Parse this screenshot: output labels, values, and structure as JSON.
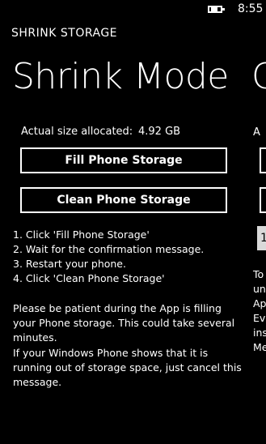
{
  "status_bar": {
    "time": "8:55",
    "battery_icon": "battery-charging-icon"
  },
  "app": {
    "title": "SHRINK STORAGE"
  },
  "pivot": {
    "current": "Shrink Mode",
    "next_peek": "C"
  },
  "allocation": {
    "label": "Actual size allocated:",
    "value": "4.92 GB"
  },
  "buttons": {
    "fill": "Fill Phone Storage",
    "clean": "Clean Phone Storage"
  },
  "steps": [
    "1. Click 'Fill Phone Storage'",
    "2. Wait for the confirmation message.",
    "3. Restart your phone.",
    "4. Click 'Clean Phone Storage'"
  ],
  "notes": {
    "patience": "Please be patient during the App is filling your Phone storage. This could take several minutes.",
    "cancel": "If your Windows Phone shows that it is running out of storage space, just cancel this message."
  },
  "peek_page": {
    "label_fragment": "A",
    "field_fragment": "1",
    "lines": [
      "To",
      "un",
      "Ap",
      "Ev",
      "ins",
      "Me"
    ]
  }
}
